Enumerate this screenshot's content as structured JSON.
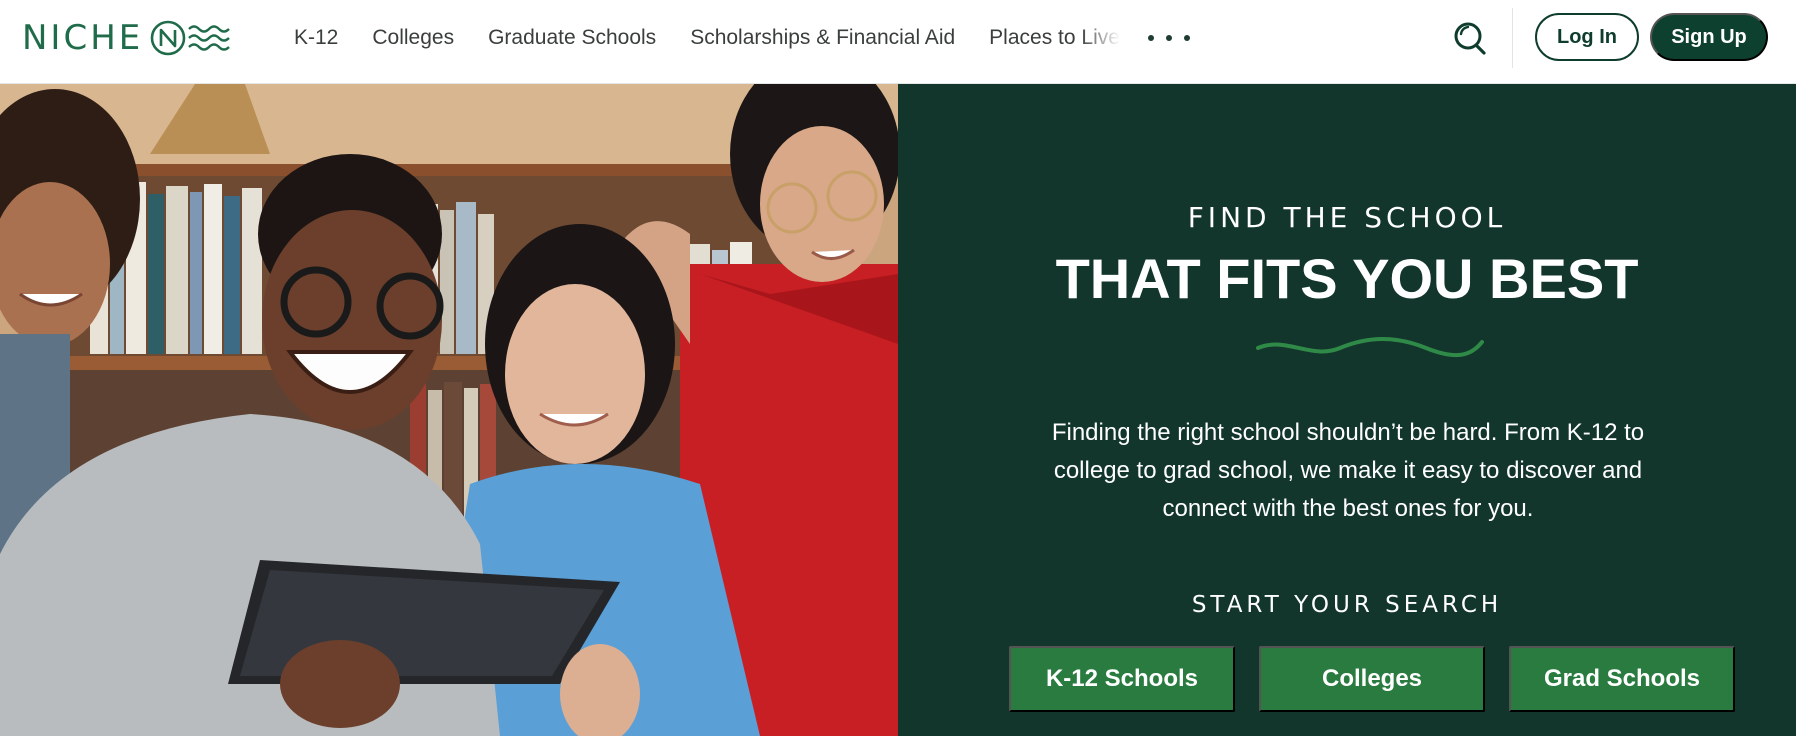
{
  "brand": {
    "name": "NICHE",
    "mark_icon": "niche-n-wave-icon",
    "color": "#1f6b4a"
  },
  "nav": {
    "items": [
      {
        "label": "K-12"
      },
      {
        "label": "Colleges"
      },
      {
        "label": "Graduate Schools"
      },
      {
        "label": "Scholarships & Financial Aid"
      },
      {
        "label": "Places to Live"
      }
    ],
    "more_icon": "ellipsis-icon",
    "search_icon": "search-icon",
    "login_label": "Log In",
    "signup_label": "Sign Up"
  },
  "hero": {
    "image_icon": "students-photo",
    "eyebrow": "FIND THE SCHOOL",
    "headline": "THAT FITS YOU BEST",
    "wave_icon": "wave-divider-icon",
    "blurb": "Finding the right school shouldn’t be hard. From K-12 to college to grad school, we make it easy to discover and connect with the best ones for you.",
    "search_label": "START YOUR SEARCH",
    "buttons": [
      {
        "label": "K-12 Schools"
      },
      {
        "label": "Colleges"
      },
      {
        "label": "Grad Schools"
      }
    ]
  },
  "colors": {
    "panel_bg": "#12362c",
    "cta_bg": "#2a7b40",
    "signup_bg": "#0e4030",
    "wave": "#2f8a47"
  }
}
